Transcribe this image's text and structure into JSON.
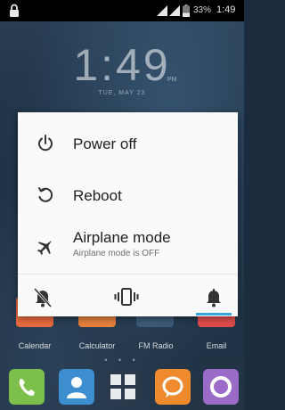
{
  "status_bar": {
    "battery_percent": "33%",
    "time": "1:49"
  },
  "lockscreen": {
    "clock": "1:49",
    "ampm": "PM",
    "date": "TUE, MAY 23"
  },
  "home": {
    "apps": [
      {
        "label": "Calendar",
        "color": "#e66a3e"
      },
      {
        "label": "Calculator",
        "color": "#e6803c"
      },
      {
        "label": "FM Radio",
        "color": "#3d5a78"
      },
      {
        "label": "Email",
        "color": "#e04b4b"
      }
    ],
    "page_indicator": "• • •",
    "dock": [
      {
        "icon": "phone-icon",
        "color": "#7cc04b"
      },
      {
        "icon": "contacts-icon",
        "color": "#3d8ed0"
      },
      {
        "icon": "app-drawer-icon",
        "color": "#e9ecef"
      },
      {
        "icon": "messaging-icon",
        "color": "#ef8a2e"
      },
      {
        "icon": "browser-icon",
        "color": "#9b6bc8"
      }
    ]
  },
  "power_menu": {
    "items": [
      {
        "title": "Power off",
        "subtitle": ""
      },
      {
        "title": "Reboot",
        "subtitle": ""
      },
      {
        "title": "Airplane mode",
        "subtitle": "Airplane mode is OFF"
      }
    ],
    "sound_modes": [
      "silent-mode-icon",
      "vibrate-mode-icon",
      "sound-on-mode-icon"
    ],
    "selected_mode": "sound-on-mode-icon",
    "accent_color": "#33a6e0"
  }
}
